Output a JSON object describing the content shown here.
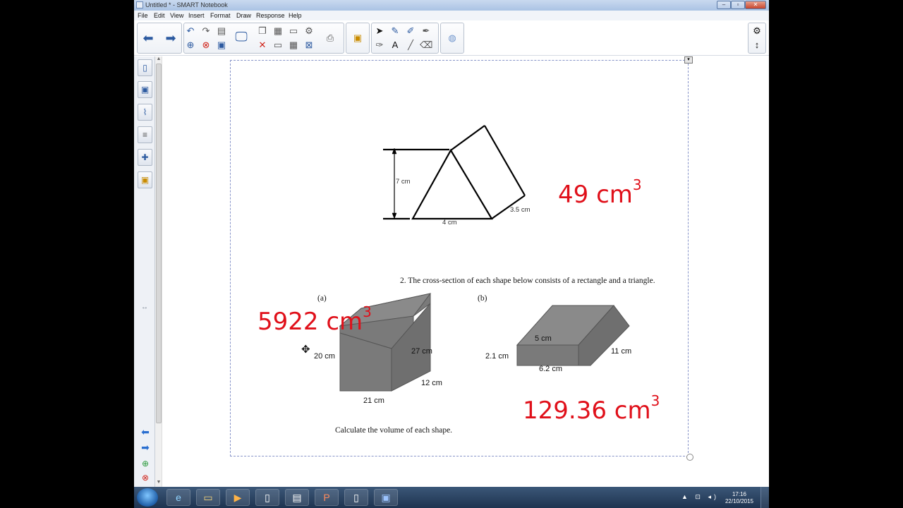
{
  "window": {
    "title": "Untitled * - SMART Notebook",
    "minimize": "–",
    "maximize": "▫",
    "close": "✕"
  },
  "menu": [
    "File",
    "Edit",
    "View",
    "Insert",
    "Format",
    "Draw",
    "Response",
    "Help"
  ],
  "worksheet": {
    "diagram1": {
      "height_label": "7 cm",
      "base_label": "4 cm",
      "depth_label": "3.5 cm"
    },
    "question2": "2. The cross-section of each shape below consists of a rectangle and a triangle.",
    "part_a": "(a)",
    "part_b": "(b)",
    "shape_a": {
      "left_label": "20 cm",
      "right_label": "27 cm",
      "depth_label": "12 cm",
      "base_label": "21 cm"
    },
    "shape_b": {
      "top_label": "5 cm",
      "left_label": "2.1 cm",
      "base_label": "6.2 cm",
      "depth_label": "11 cm"
    },
    "instruction": "Calculate the volume of each shape."
  },
  "answers": {
    "a1": {
      "value": "49 cm",
      "exp": "3"
    },
    "a2": {
      "value": "5922 cm",
      "exp": "3"
    },
    "a3": {
      "value": "129.36 cm",
      "exp": "3"
    }
  },
  "taskbar": {
    "time": "17:16",
    "date": "22/10/2015"
  },
  "colors": {
    "answer": "#e0101a",
    "shape_fill": "#7a7a7a"
  }
}
